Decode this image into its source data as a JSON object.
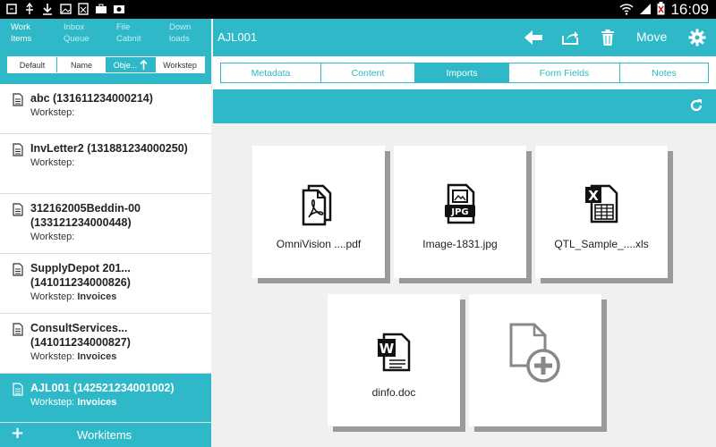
{
  "status": {
    "time": "16:09"
  },
  "left": {
    "nav_tabs": [
      {
        "label": "Work\nItems",
        "active": true
      },
      {
        "label": "Inbox\nQueue",
        "active": false
      },
      {
        "label": "File\nCabnit",
        "active": false
      },
      {
        "label": "Down\nloads",
        "active": false
      }
    ],
    "sort": [
      {
        "label": "Default",
        "active": false
      },
      {
        "label": "Name",
        "active": false
      },
      {
        "label": "Obje...",
        "active": true
      },
      {
        "label": "Workstep",
        "active": false
      }
    ],
    "workstep_label": "Workstep:",
    "items": [
      {
        "title": "abc (131611234000214)",
        "workstep": ""
      },
      {
        "title": "InvLetter2 (131881234000250)",
        "workstep": ""
      },
      {
        "title": "312162005Beddin-00 (133121234000448)",
        "workstep": ""
      },
      {
        "title": "SupplyDepot 201... (141011234000826)",
        "workstep": "Invoices"
      },
      {
        "title": "ConsultServices... (141011234000827)",
        "workstep": "Invoices"
      },
      {
        "title": "AJL001 (142521234001002)",
        "workstep": "Invoices"
      }
    ],
    "bottom_label": "Workitems"
  },
  "right": {
    "title": "AJL001",
    "move_label": "Move",
    "tabs": [
      {
        "label": "Metadata",
        "active": false
      },
      {
        "label": "Content",
        "active": false
      },
      {
        "label": "Imports",
        "active": true
      },
      {
        "label": "Form Fields",
        "active": false
      },
      {
        "label": "Notes",
        "active": false
      }
    ],
    "files": [
      {
        "name": "OmniVision ....pdf",
        "icon": "pdf-file-icon"
      },
      {
        "name": "Image-1831.jpg",
        "icon": "jpg-file-icon"
      },
      {
        "name": "QTL_Sample_....xls",
        "icon": "xls-file-icon"
      },
      {
        "name": "dinfo.doc",
        "icon": "doc-file-icon"
      }
    ],
    "add_icon": "add-file-icon"
  },
  "colors": {
    "accent": "#2fb9c8"
  }
}
